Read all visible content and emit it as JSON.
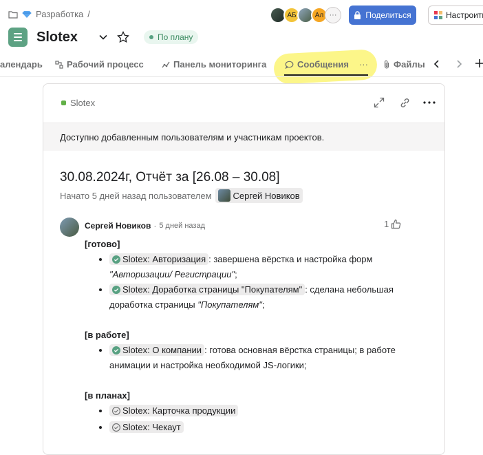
{
  "breadcrumb": {
    "section": "Разработка",
    "separator": "/"
  },
  "avatars": [
    "АБ",
    "Ал"
  ],
  "share": {
    "label": "Поделиться"
  },
  "customize": {
    "label": "Настроить"
  },
  "project": {
    "title": "Slotex",
    "status": "По плану"
  },
  "tabs": [
    {
      "label": "алендарь"
    },
    {
      "label": "Рабочий процесс"
    },
    {
      "label": "Панель мониторинга"
    },
    {
      "label": "Сообщения",
      "more": "···"
    },
    {
      "label": "Файлы"
    }
  ],
  "card": {
    "project_chip": "Slotex",
    "notice": "Доступно добавленным пользователям и участникам проектов.",
    "title": "30.08.2024г, Отчёт за [26.08 – 30.08]",
    "started_prefix": "Начато 5 дней назад пользователем",
    "started_user": "Сергей Новиков"
  },
  "comment": {
    "author": "Сергей Новиков",
    "sep": "·",
    "time": "5 дней назад",
    "likes": "1",
    "sections": [
      {
        "heading": "[готово]",
        "items": [
          {
            "task": "Slotex: Авторизация",
            "rest": ": завершена вёрстка и настройка форм ",
            "em": "\"Авторизации/ Регистрации\"",
            "tail": ";",
            "done": true
          },
          {
            "task": "Slotex: Доработка страницы \"Покупателям\"",
            "rest": ": сделана небольшая доработка страницы ",
            "em": "\"Покупателям\"",
            "tail": ";",
            "done": true
          }
        ]
      },
      {
        "heading": "[в работе]",
        "items": [
          {
            "task": "Slotex: О компании",
            "rest": ": готова основная вёрстка страницы; в работе анимации и настройка необходимой JS-логики;",
            "em": "",
            "tail": "",
            "done": true
          }
        ]
      },
      {
        "heading": "[в планах]",
        "items": [
          {
            "task": "Slotex: Карточка продукции",
            "rest": "",
            "em": "",
            "tail": "",
            "done": false
          },
          {
            "task": "Slotex: Чекаут",
            "rest": "",
            "em": "",
            "tail": "",
            "done": false
          }
        ]
      }
    ]
  },
  "colors": {
    "accent": "#4573d2",
    "project": "#5da283",
    "done": "#58a182",
    "highlight": "#fbf46b"
  }
}
